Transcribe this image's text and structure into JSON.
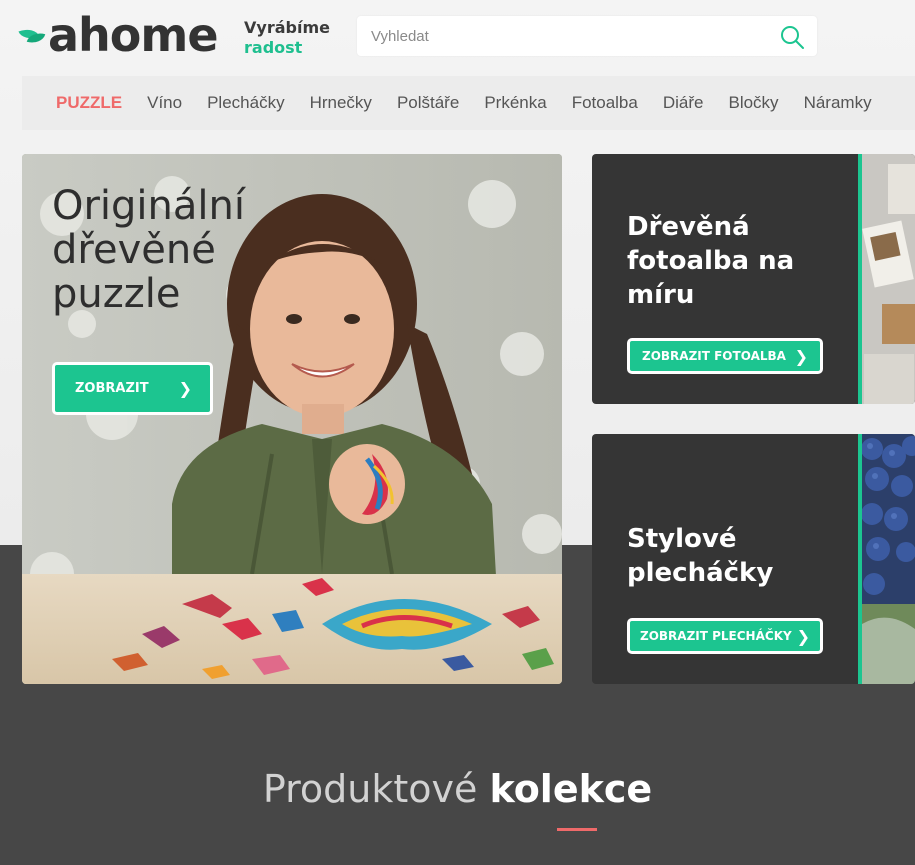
{
  "header": {
    "logo_text": "ahome",
    "slogan_line1": "Vyrábíme",
    "slogan_line2": "radost",
    "search_placeholder": "Vyhledat",
    "search_icon": "search-icon"
  },
  "nav": {
    "items": [
      "PUZZLE",
      "Víno",
      "Plecháčky",
      "Hrnečky",
      "Polštáře",
      "Prkénka",
      "Fotoalba",
      "Diáře",
      "Bločky",
      "Náramky"
    ],
    "active_index": 0
  },
  "hero": {
    "title": "Originální dřevěné puzzle",
    "button_label": "ZOBRAZIT"
  },
  "cards": [
    {
      "title": "Dřevěná fotoalba na míru",
      "button_label": "ZOBRAZIT FOTOALBA"
    },
    {
      "title": "Stylové plecháčky",
      "button_label": "ZOBRAZIT PLECHÁČKY"
    }
  ],
  "section": {
    "title_light": "Produktové",
    "title_bold": "kolekce"
  },
  "colors": {
    "brand_green": "#1cc590",
    "accent_red": "#ef6a6a",
    "dark_card": "#353535"
  }
}
